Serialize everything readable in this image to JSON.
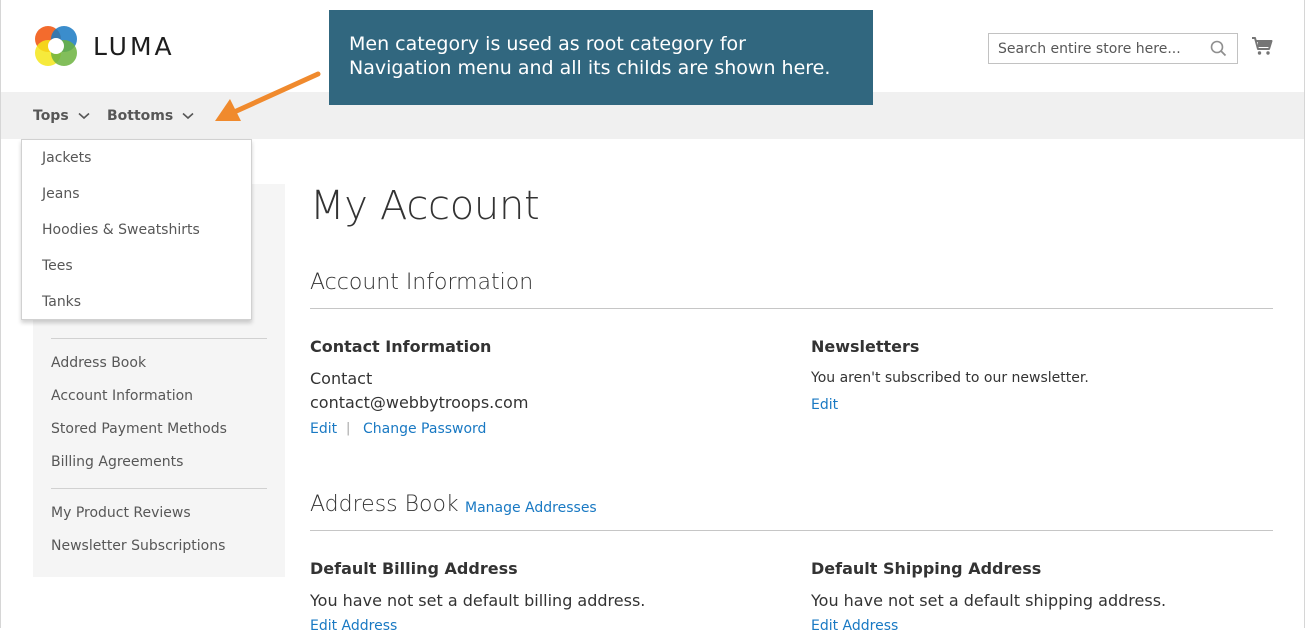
{
  "header": {
    "logo_text": "LUMA",
    "search_placeholder": "Search entire store here..."
  },
  "nav": {
    "items": [
      {
        "label": "Tops"
      },
      {
        "label": "Bottoms"
      }
    ]
  },
  "callout": {
    "line1": "Men category is used as root category for",
    "line2": "Navigation menu and all its childs are shown here."
  },
  "dropdown": {
    "items": [
      "Jackets",
      "Jeans",
      "Hoodies & Sweatshirts",
      "Tees",
      "Tanks"
    ]
  },
  "sidebar": {
    "items": [
      "Address Book",
      "Account Information",
      "Stored Payment Methods",
      "Billing Agreements",
      "My Product Reviews",
      "Newsletter Subscriptions"
    ]
  },
  "main": {
    "page_title": "My Account",
    "account_info": {
      "title": "Account Information",
      "contact_title": "Contact Information",
      "contact_name": "Contact",
      "contact_email": "contact@webbytroops.com",
      "edit_label": "Edit",
      "separator": "|",
      "change_password_label": "Change Password",
      "newsletters_title": "Newsletters",
      "newsletters_text": "You aren't subscribed to our newsletter.",
      "newsletters_edit_label": "Edit"
    },
    "address_book": {
      "title": "Address Book",
      "manage_label": "Manage Addresses",
      "billing_title": "Default Billing Address",
      "billing_text": "You have not set a default billing address.",
      "billing_edit": "Edit Address",
      "shipping_title": "Default Shipping Address",
      "shipping_text": "You have not set a default shipping address.",
      "shipping_edit": "Edit Address"
    }
  },
  "colors": {
    "link": "#1979c3",
    "callout_bg": "#31677f",
    "arrow": "#f08a2d",
    "nav_bg": "#f0f0f0",
    "sidebar_bg": "#f5f5f5"
  }
}
